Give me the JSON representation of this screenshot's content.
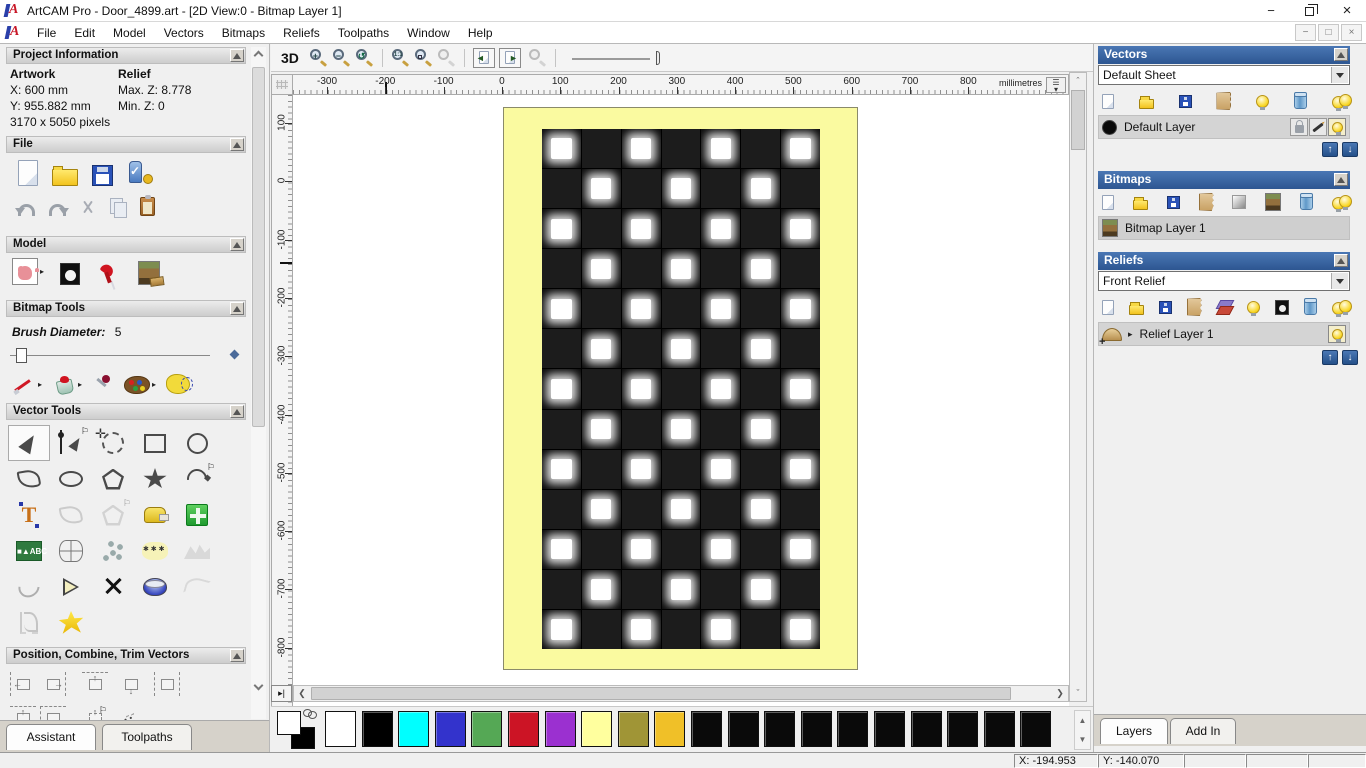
{
  "window": {
    "title": "ArtCAM Pro - Door_4899.art - [2D View:0 - Bitmap Layer 1]",
    "controls": [
      "minimize-icon",
      "restore-icon",
      "close-icon"
    ]
  },
  "menu": {
    "items": [
      "File",
      "Edit",
      "Model",
      "Vectors",
      "Bitmaps",
      "Reliefs",
      "Toolpaths",
      "Window",
      "Help"
    ],
    "mdi_controls": [
      "minimize-icon",
      "restore-icon",
      "close-icon"
    ]
  },
  "view_toolbar": {
    "btn_3d": "3D",
    "icons": [
      "zoom-in-icon",
      "zoom-out-icon",
      "zoom-previous-icon",
      "zoom-1to1-icon",
      "zoom-object-icon",
      "zoom-selection-icon",
      "toggle-left-page-icon",
      "toggle-right-page-icon",
      "zoom-disabled-icon",
      "zoom-slider"
    ]
  },
  "assistant": {
    "project_information": {
      "title": "Project Information",
      "artwork_label": "Artwork",
      "relief_label": "Relief",
      "x": "X: 600 mm",
      "y": "Y: 955.882 mm",
      "pixels": "3170 x 5050 pixels",
      "max_z": "Max. Z: 8.778",
      "min_z": "Min. Z: 0"
    },
    "file_section": {
      "title": "File",
      "icons": [
        "new-model-icon",
        "open-model-icon",
        "save-model-icon",
        "save-as-icon",
        "undo-icon",
        "redo-icon",
        "cut-icon",
        "copy-icon",
        "paste-icon"
      ]
    },
    "model_section": {
      "title": "Model",
      "icons": [
        "adjust-model-icon",
        "invert-model-icon",
        "light-model-icon",
        "lightbox-icon"
      ]
    },
    "bitmap_tools": {
      "title": "Bitmap Tools",
      "brush_label": "Brush Diameter:",
      "brush_value": "5",
      "icons": [
        "paint-brush-icon",
        "flood-fill-icon",
        "pick-colour-icon",
        "palette-icon",
        "magic-select-icon"
      ]
    },
    "vector_tools": {
      "title": "Vector Tools",
      "icons": [
        "select-vectors-icon",
        "node-edit-icon",
        "transform-icon",
        "rectangle-icon",
        "circle-icon",
        "polyline-icon",
        "ellipse-icon",
        "polygon-icon",
        "star-icon",
        "arc-icon",
        "text-icon",
        "wrap-text-icon",
        "offset-icon",
        "measure-icon",
        "paste-special-icon",
        "text-block-icon",
        "envelope-distort-icon",
        "block-paste-icon",
        "nest-icon",
        "fade-vectors-icon",
        "fit-arcs-icon",
        "bisector-icon",
        "trim-vectors-icon",
        "extrude-icon",
        "spline-icon",
        "section-icon",
        "vector-doctor-icon"
      ]
    },
    "position_section": {
      "title": "Position, Combine, Trim Vectors",
      "icons": [
        "align-left-icon",
        "align-right-icon",
        "align-top-icon",
        "align-bottom-icon",
        "align-center-x-icon",
        "align-center-icon",
        "align-in-box-icon",
        "align-contour-icon",
        "scatter-icon",
        "nesting-icon"
      ]
    },
    "tabs": [
      {
        "label": "Assistant",
        "active": true
      },
      {
        "label": "Toolpaths",
        "active": false
      }
    ]
  },
  "rulers": {
    "horizontal": [
      "-300",
      "-200",
      "-100",
      "0",
      "100",
      "200",
      "300",
      "400",
      "500",
      "600",
      "700",
      "800"
    ],
    "vertical": [
      "100",
      "0",
      "-100",
      "-200",
      "-300",
      "-400",
      "-500",
      "-600",
      "-700",
      "-800"
    ],
    "units": "millimetres"
  },
  "canvas": {
    "door_color": "#fafaa0",
    "tile_color": "#1c1c1c",
    "pattern_rows": 13,
    "pattern_cols": 7
  },
  "palette": {
    "colors": [
      "#ffffff",
      "#000000",
      "#00ffff",
      "#3333cc",
      "#55a855",
      "#cc1425",
      "#9b30d0",
      "#ffff9e",
      "#a09536",
      "#f0c028",
      "#0a0a0a",
      "#0a0a0a",
      "#0a0a0a",
      "#0a0a0a",
      "#0a0a0a",
      "#0a0a0a",
      "#0a0a0a",
      "#0a0a0a",
      "#0a0a0a",
      "#0a0a0a"
    ]
  },
  "panels": {
    "vectors": {
      "title": "Vectors",
      "sheet_value": "Default Sheet",
      "toolbar_icons": [
        "new-layer-icon",
        "open-layer-icon",
        "save-layer-icon",
        "merge-layers-icon",
        "toggle-visibility-icon",
        "delete-layer-icon",
        "all-layers-visible-icon"
      ],
      "layer_name": "Default Layer",
      "layer_icons": [
        "lock-layer-icon",
        "snap-layer-icon",
        "layer-visible-icon"
      ]
    },
    "bitmaps": {
      "title": "Bitmaps",
      "toolbar_icons": [
        "new-layer-icon",
        "open-layer-icon",
        "save-layer-icon",
        "merge-layers-icon",
        "greyscale-icon",
        "copy-bitmap-icon",
        "delete-layer-icon",
        "all-layers-visible-icon"
      ],
      "layer_name": "Bitmap Layer 1"
    },
    "reliefs": {
      "title": "Reliefs",
      "relief_value": "Front Relief",
      "toolbar_icons": [
        "new-layer-icon",
        "open-layer-icon",
        "save-layer-icon",
        "merge-layers-icon",
        "stack-layers-icon",
        "toggle-visibility-icon",
        "greyscale-relief-icon",
        "delete-layer-icon",
        "all-layers-visible-icon"
      ],
      "layer_name": "Relief Layer 1",
      "layer_icons": [
        "layer-visible-icon"
      ]
    },
    "tabs": [
      {
        "label": "Layers",
        "active": true
      },
      {
        "label": "Add In",
        "active": false
      }
    ]
  },
  "status_bar": {
    "x": "X: -194.953",
    "y": "Y: -140.070"
  }
}
